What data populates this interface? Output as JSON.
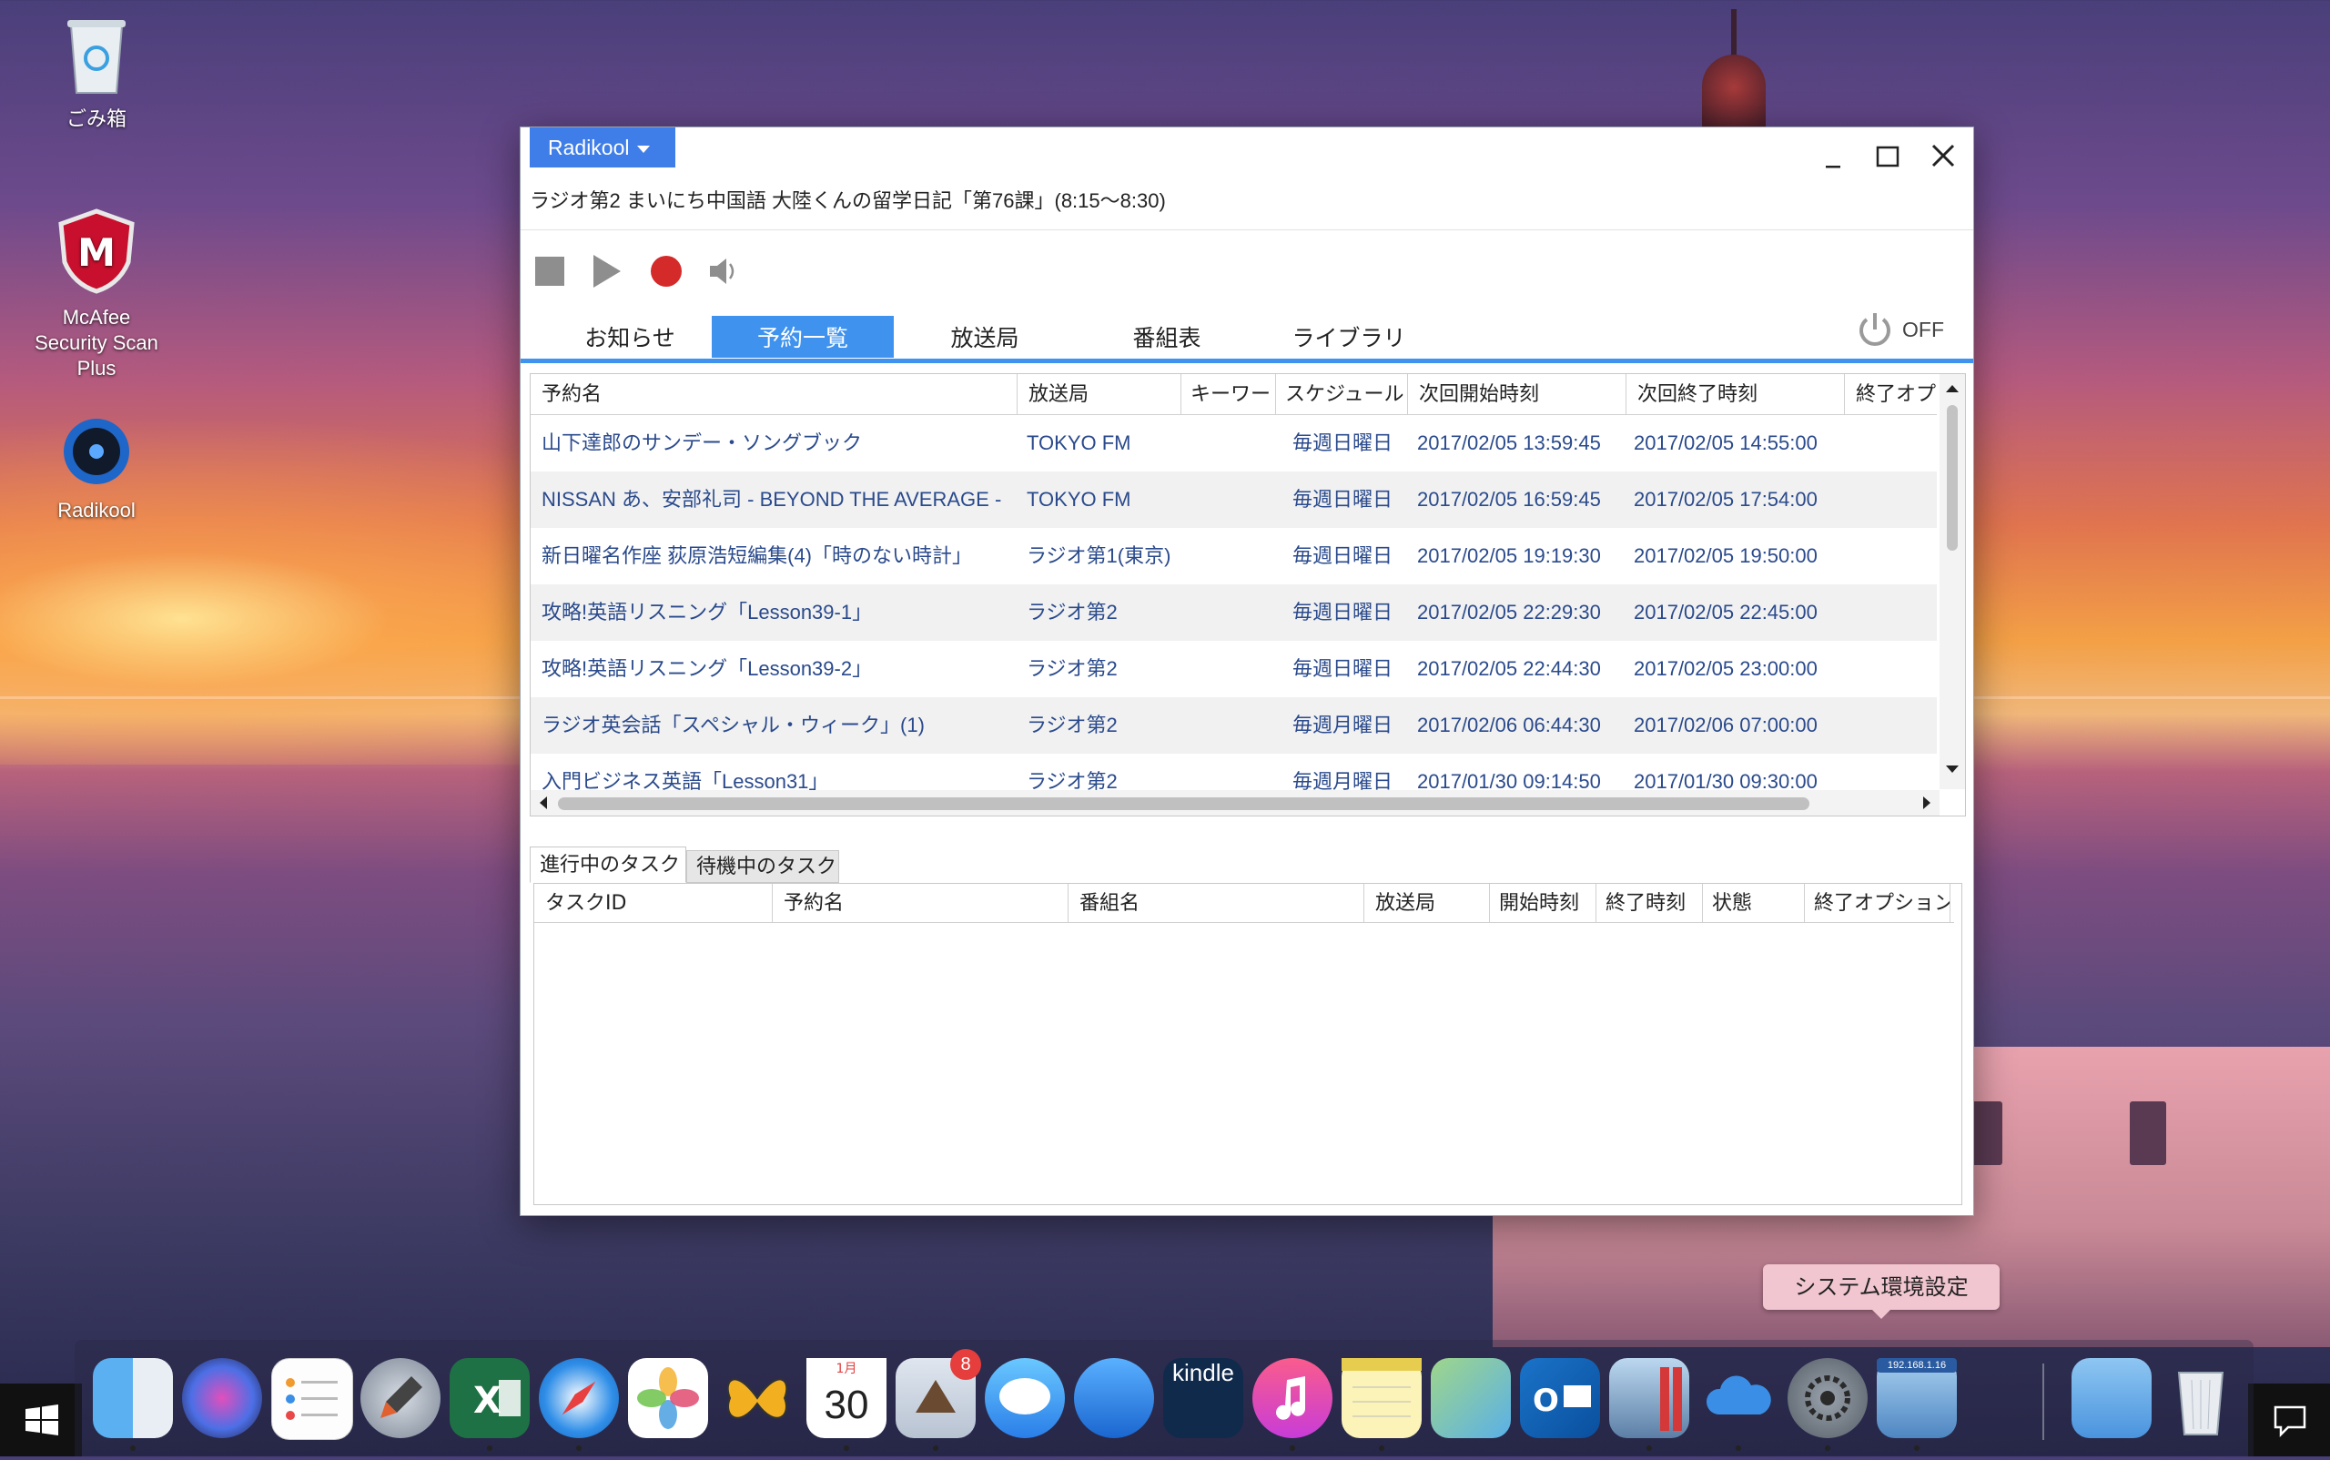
{
  "desktop": {
    "icons": [
      {
        "label": "ごみ箱"
      },
      {
        "label": "McAfee Security Scan Plus"
      },
      {
        "label": "Radikool"
      }
    ]
  },
  "window": {
    "app_menu_label": "Radikool",
    "now_playing": "ラジオ第2 まいにち中国語 大陸くんの留学日記「第76課」(8:15～8:30)",
    "power_label": "OFF",
    "tabs": [
      {
        "label": "お知らせ",
        "active": false
      },
      {
        "label": "予約一覧",
        "active": true
      },
      {
        "label": "放送局",
        "active": false
      },
      {
        "label": "番組表",
        "active": false
      },
      {
        "label": "ライブラリ",
        "active": false
      }
    ],
    "reservations": {
      "columns": [
        "予約名",
        "放送局",
        "キーワード",
        "スケジュール",
        "次回開始時刻",
        "次回終了時刻",
        "終了オプ"
      ],
      "rows": [
        {
          "name": "山下達郎のサンデー・ソングブック",
          "station": "TOKYO FM",
          "keyword": "",
          "schedule": "毎週日曜日",
          "start": "2017/02/05 13:59:45",
          "end": "2017/02/05 14:55:00"
        },
        {
          "name": "NISSAN あ、安部礼司 - BEYOND THE AVERAGE -",
          "station": "TOKYO FM",
          "keyword": "",
          "schedule": "毎週日曜日",
          "start": "2017/02/05 16:59:45",
          "end": "2017/02/05 17:54:00"
        },
        {
          "name": "新日曜名作座 荻原浩短編集(4)「時のない時計」",
          "station": "ラジオ第1(東京)",
          "keyword": "",
          "schedule": "毎週日曜日",
          "start": "2017/02/05 19:19:30",
          "end": "2017/02/05 19:50:00"
        },
        {
          "name": "攻略!英語リスニング「Lesson39-1」",
          "station": "ラジオ第2",
          "keyword": "",
          "schedule": "毎週日曜日",
          "start": "2017/02/05 22:29:30",
          "end": "2017/02/05 22:45:00"
        },
        {
          "name": "攻略!英語リスニング「Lesson39-2」",
          "station": "ラジオ第2",
          "keyword": "",
          "schedule": "毎週日曜日",
          "start": "2017/02/05 22:44:30",
          "end": "2017/02/05 23:00:00"
        },
        {
          "name": "ラジオ英会話「スペシャル・ウィーク」(1)",
          "station": "ラジオ第2",
          "keyword": "",
          "schedule": "毎週月曜日",
          "start": "2017/02/06 06:44:30",
          "end": "2017/02/06 07:00:00"
        },
        {
          "name": "入門ビジネス英語「Lesson31」",
          "station": "ラジオ第2",
          "keyword": "",
          "schedule": "毎週月曜日",
          "start": "2017/01/30 09:14:50",
          "end": "2017/01/30 09:30:00"
        }
      ]
    },
    "task_tabs": [
      {
        "label": "進行中のタスク",
        "active": true
      },
      {
        "label": "待機中のタスク",
        "active": false
      }
    ],
    "task_columns": [
      "タスクID",
      "予約名",
      "番組名",
      "放送局",
      "開始時刻",
      "終了時刻",
      "状態",
      "終了オプション"
    ]
  },
  "tooltip": "システム環境設定",
  "dock": {
    "icons": [
      "finder",
      "siri",
      "reminders",
      "launchpad",
      "excel",
      "safari",
      "photos",
      "tes",
      "calendar",
      "mail",
      "messages",
      "speech",
      "kindle",
      "itunes",
      "notes",
      "maps",
      "outlook",
      "remote-desktop",
      "icloud",
      "system-preferences",
      "windows-remote",
      "folder",
      "trash"
    ],
    "calendar": {
      "month": "1月",
      "day": "30"
    },
    "mail_badge": "8",
    "kindle_label": "kindle",
    "remote_label": "192.168.1.16"
  },
  "colors": {
    "accent": "#3f93ee",
    "app_menu": "#3f7ee8",
    "record": "#d42a2a",
    "link_text": "#2a4a8c"
  }
}
